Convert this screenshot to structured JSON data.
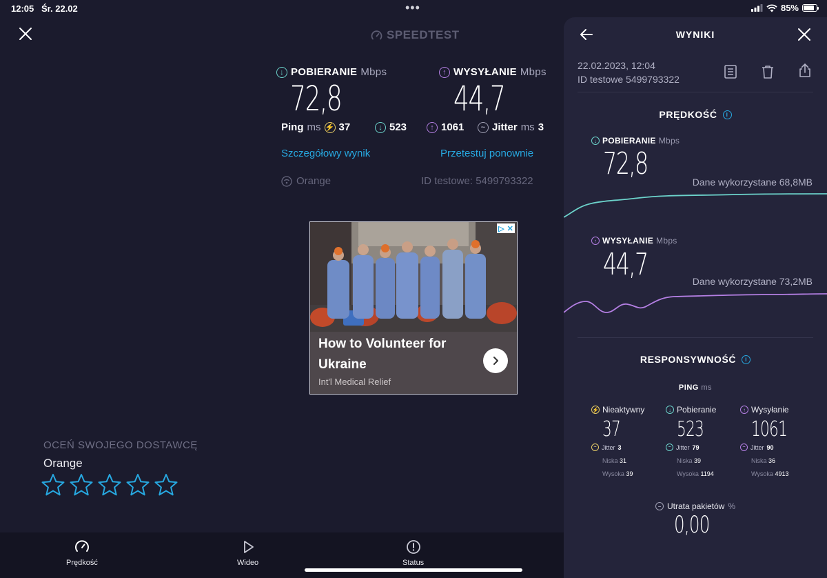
{
  "status_bar": {
    "time": "12:05",
    "date": "Śr. 22.02",
    "dots": "•••",
    "battery": "85%",
    "battery_level": 0.85
  },
  "header": {
    "logo_text": "SPEEDTEST"
  },
  "result": {
    "download": {
      "label": "POBIERANIE",
      "unit": "Mbps",
      "value": "72,8"
    },
    "upload": {
      "label": "WYSYŁANIE",
      "unit": "Mbps",
      "value": "44,7"
    },
    "ping": {
      "label": "Ping",
      "unit": "ms",
      "idle": "37",
      "download": "523",
      "upload": "1061"
    },
    "jitter": {
      "label": "Jitter",
      "unit": "ms",
      "value": "3"
    },
    "detail_link": "Szczegółowy wynik",
    "retest_link": "Przetestuj ponownie",
    "provider": "Orange",
    "test_id": "ID testowe: 5499793322"
  },
  "ad": {
    "title": "How to Volunteer for Ukraine",
    "subtitle": "Int'l Medical Relief"
  },
  "rating": {
    "title": "OCEŃ SWOJEGO DOSTAWCĘ",
    "provider": "Orange",
    "stars_total": 5,
    "stars_selected": 0
  },
  "tabbar": {
    "tabs": [
      {
        "label": "Prędkość",
        "icon": "speedometer-icon"
      },
      {
        "label": "Wideo",
        "icon": "play-icon"
      },
      {
        "label": "Status",
        "icon": "alert-icon"
      }
    ]
  },
  "panel": {
    "title": "WYNIKI",
    "date": "22.02.2023, 12:04",
    "test_id": "ID testowe 5499793322",
    "speed_section": "PRĘDKOŚĆ",
    "download": {
      "label": "POBIERANIE",
      "unit": "Mbps",
      "value": "72,8",
      "data_used": "Dane wykorzystane 68,8MB"
    },
    "upload": {
      "label": "WYSYŁANIE",
      "unit": "Mbps",
      "value": "44,7",
      "data_used": "Dane wykorzystane 73,2MB"
    },
    "responsiveness_section": "RESPONSYWNOŚĆ",
    "ping_label": "PING",
    "ping_unit": "ms",
    "columns": [
      {
        "label": "Nieaktywny",
        "value": "37",
        "jitter_label": "Jitter",
        "jitter": "3",
        "low_label": "Niska",
        "low": "31",
        "high_label": "Wysoka",
        "high": "39"
      },
      {
        "label": "Pobieranie",
        "value": "523",
        "jitter_label": "Jitter",
        "jitter": "79",
        "low_label": "Niska",
        "low": "39",
        "high_label": "Wysoka",
        "high": "1194"
      },
      {
        "label": "Wysyłanie",
        "value": "1061",
        "jitter_label": "Jitter",
        "jitter": "90",
        "low_label": "Niska",
        "low": "36",
        "high_label": "Wysoka",
        "high": "4913"
      }
    ],
    "packet_loss_label": "Utrata pakietów",
    "packet_loss_unit": "%",
    "packet_loss_value": "0,00"
  },
  "colors": {
    "background": "#1b1b2d",
    "panel": "#24243a",
    "download": "#6cd3cb",
    "upload": "#b47fe3",
    "ping": "#e6cc67",
    "link": "#27a8e0"
  }
}
